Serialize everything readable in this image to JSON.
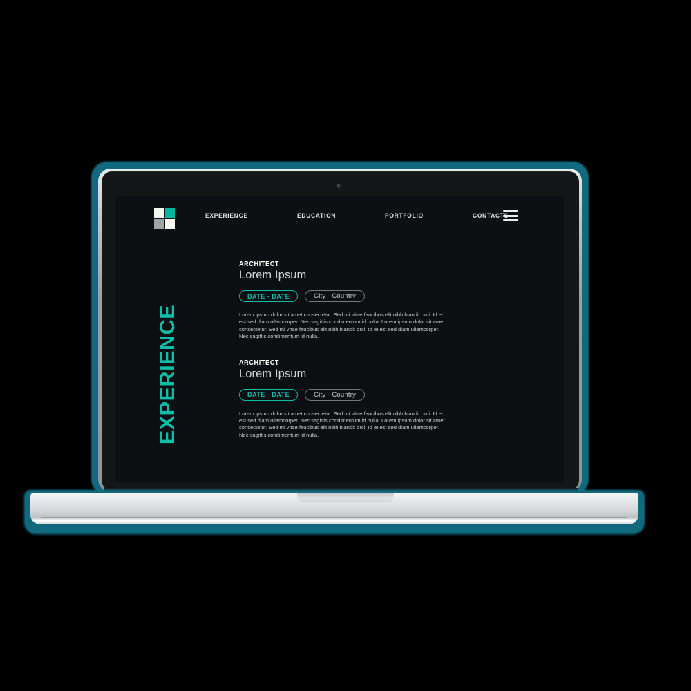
{
  "theme": {
    "accent": "#0fbda8",
    "page_bg": "#0d1012",
    "text": "#e8eaeb",
    "muted_text": "#c9cdcf",
    "chip_border_muted": "#70797d",
    "laptop_outline": "#10697c"
  },
  "device": {
    "type": "laptop",
    "webcam_icon": "webcam-dot-icon"
  },
  "nav": {
    "logo": {
      "icon": "four-square-logo-icon",
      "cells": [
        {
          "name": "top-left",
          "color": "#f4f4f0"
        },
        {
          "name": "top-right",
          "color": "#06b6a0"
        },
        {
          "name": "bottom-left",
          "color": "#9ea3a5"
        },
        {
          "name": "bottom-right",
          "color": "#f7f7f4"
        }
      ]
    },
    "links": [
      {
        "label": "EXPERIENCE"
      },
      {
        "label": "EDUCATION"
      },
      {
        "label": "PORTFOLIO"
      },
      {
        "label": "CONTACTS"
      }
    ],
    "menu_toggle_icon": "hamburger-menu-icon"
  },
  "section": {
    "vertical_title": "EXPERIENCE"
  },
  "entries": [
    {
      "role": "ARCHITECT",
      "name": "Lorem Ipsum",
      "date_chip": "DATE - DATE",
      "place_chip": "City - Country",
      "body": "Lorem ipsum dolor sit amet consectetur. Sed mi vitae faucibus elit nibh blandit orci. Id et est sed diam ullamcorper. Nec sagittis condimentum id nulla. Lorem ipsum dolor sit amet consectetur. Sed mi vitae faucibus elit nibh blandit orci. Id et est sed diam ullamcorper. Nec sagittis condimentum id nulla."
    },
    {
      "role": "ARCHITECT",
      "name": "Lorem Ipsum",
      "date_chip": "DATE - DATE",
      "place_chip": "City - Country",
      "body": "Lorem ipsum dolor sit amet consectetur. Sed mi vitae faucibus elit nibh blandit orci. Id et est sed diam ullamcorper. Nec sagittis condimentum id nulla. Lorem ipsum dolor sit amet consectetur. Sed mi vitae faucibus elit nibh blandit orci. Id et est sed diam ullamcorper. Nec sagittis condimentum id nulla."
    }
  ]
}
